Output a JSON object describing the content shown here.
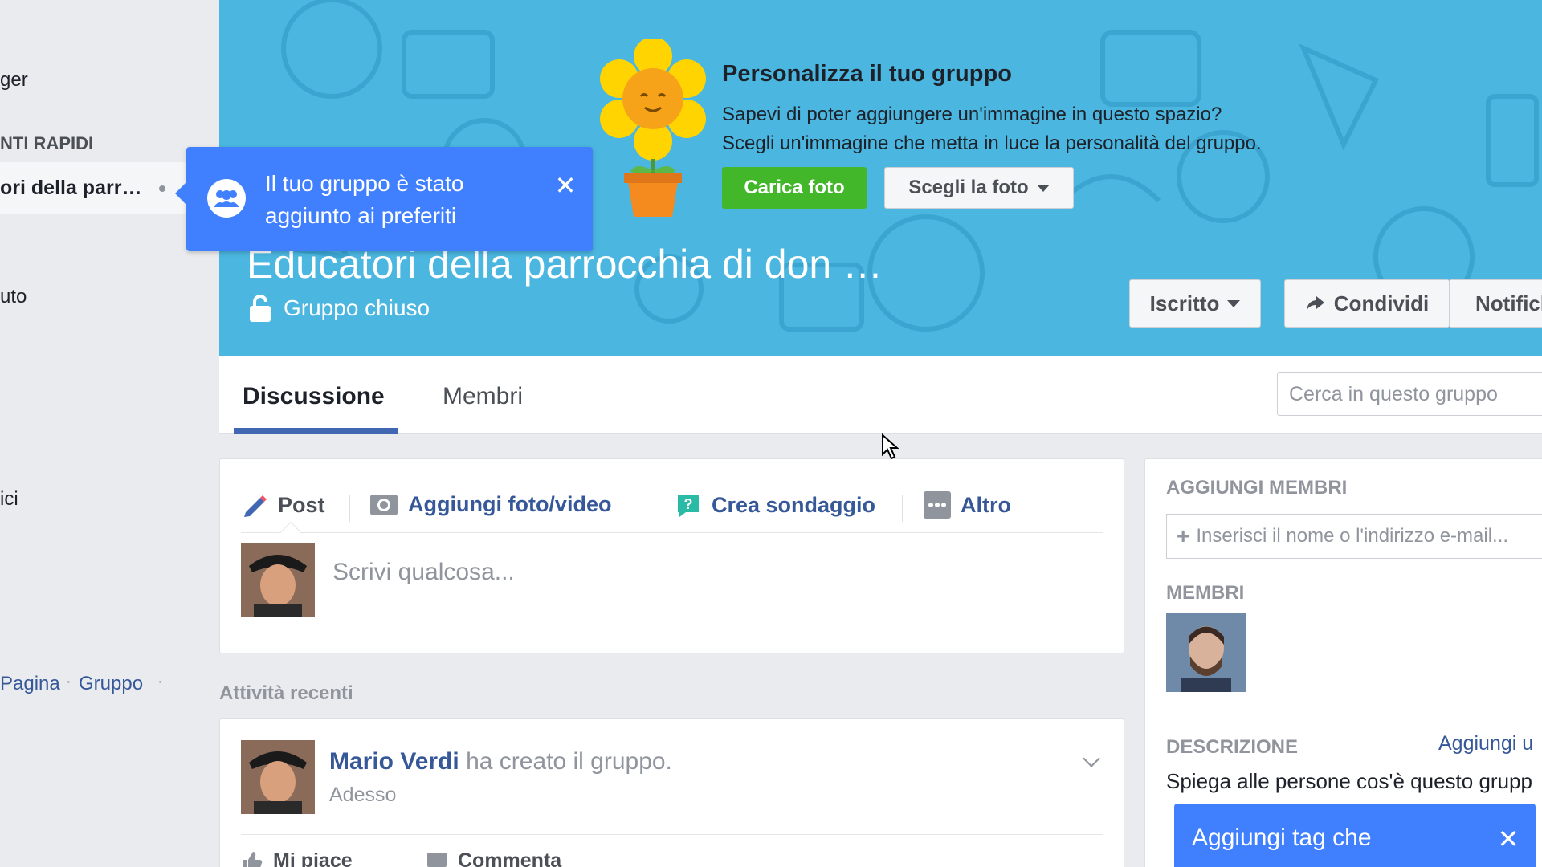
{
  "sidebar": {
    "item_1": "ger",
    "section_header": "NTI RAPIDI",
    "active_group": "ori della parr…",
    "item_3": "uto",
    "item_4": "ici",
    "footer_link_page": "Pagina",
    "footer_link_group": "Gruppo",
    "footer_sep": "·"
  },
  "cover_promo": {
    "title": "Personalizza il tuo gruppo",
    "line1": "Sapevi di poter aggiungere un'immagine in questo spazio?",
    "line2": "Scegli un'immagine che metta in luce la personalità del gruppo.",
    "upload_button": "Carica foto",
    "choose_button": "Scegli la foto"
  },
  "favorites_tooltip": {
    "text": "Il tuo gruppo è stato aggiunto ai preferiti",
    "close": "✕"
  },
  "group": {
    "title": "Educatori della parrocchia di don …",
    "privacy": "Gruppo chiuso",
    "joined_button": "Iscritto",
    "share_button": "Condividi",
    "notifications_button": "Notifiche"
  },
  "tabs": {
    "discussion": "Discussione",
    "members": "Membri",
    "search_placeholder": "Cerca in questo gruppo"
  },
  "composer": {
    "post": "Post",
    "photo_video": "Aggiungi foto/video",
    "poll": "Crea sondaggio",
    "more": "Altro",
    "placeholder": "Scrivi qualcosa..."
  },
  "recent_activity_label": "Attività recenti",
  "post": {
    "author": "Mario Verdi",
    "action": "ha creato il gruppo.",
    "time": "Adesso",
    "like": "Mi piace",
    "comment": "Commenta"
  },
  "right_column": {
    "add_members_header": "AGGIUNGI MEMBRI",
    "add_members_placeholder": "Inserisci il nome o l'indirizzo e-mail...",
    "members_header": "MEMBRI",
    "description_header": "DESCRIZIONE",
    "description_link": "Aggiungi u",
    "description_text": "Spiega alle persone cos'è questo grupp"
  },
  "tag_tooltip": {
    "text": "Aggiungi tag che",
    "close": "✕"
  },
  "colors": {
    "cover_blue": "#4bb6df",
    "fb_blue": "#4267b2",
    "link_blue": "#365899",
    "tooltip_blue": "#4080ff",
    "green": "#42b72a"
  }
}
